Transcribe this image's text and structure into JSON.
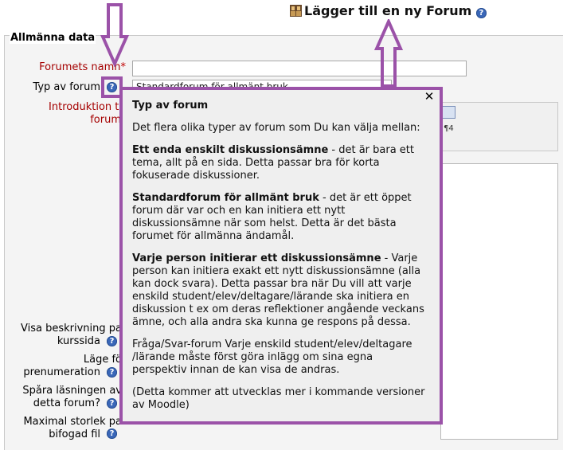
{
  "header": {
    "title": "Lägger till en ny Forum",
    "icon": "forum-icon",
    "help": "?"
  },
  "form": {
    "section_legend": "Allmänna data",
    "forum_name_label": "Forumets namn",
    "required_star": "*",
    "forum_type_label": "Typ av forum",
    "forum_type_value": "Standardforum för allmänt bruk",
    "intro_label_1": "Introduktion ti",
    "intro_label_2": "forum",
    "show_desc_label_1": "Visa beskrivning pa",
    "show_desc_label_2": "kurssida",
    "subscription_label_1": "Läge fö",
    "subscription_label_2": "prenumeration",
    "track_label_1": "Spåra läsningen av",
    "track_label_2": "detta forum?",
    "maxsize_label_1": "Maximal storlek pa",
    "maxsize_label_2": "bifogad fil"
  },
  "popup": {
    "title": "Typ av forum",
    "close": "✕",
    "intro": "Det flera olika typer av forum som Du kan välja mellan:",
    "single_title": "Ett enda enskilt diskussionsämne",
    "single_text": " - det är bara ett tema, allt på en sida. Detta passar bra för korta fokuserade diskussioner.",
    "general_title": "Standardforum för allmänt bruk",
    "general_text": " - det är ett öppet forum där var och en kan initiera ett nytt diskussionsämne när som helst. Detta är det bästa forumet för allmänna ändamål.",
    "eachuser_title": "Varje person initierar ett diskussionsämne",
    "eachuser_text": " - Varje person kan initiera exakt ett nytt diskussionsämne (alla kan dock svara). Detta passar bra när Du vill att varje enskild student/elev/deltagare/lärande ska initiera en diskussion t ex om deras reflektioner angående veckans ämne, och alla andra ska kunna ge respons på dessa.",
    "qanda_text": "Fråga/Svar-forum Varje enskild student/elev/deltagare /lärande måste först göra inlägg om sina egna perspektiv innan de kan visa de andras.",
    "note_text": "(Detta kommer att utvecklas mer i kommande versioner av Moodle)"
  },
  "colors": {
    "annotation": "#9b52a8",
    "help_icon": "#3a67b8",
    "required": "#a50000"
  }
}
